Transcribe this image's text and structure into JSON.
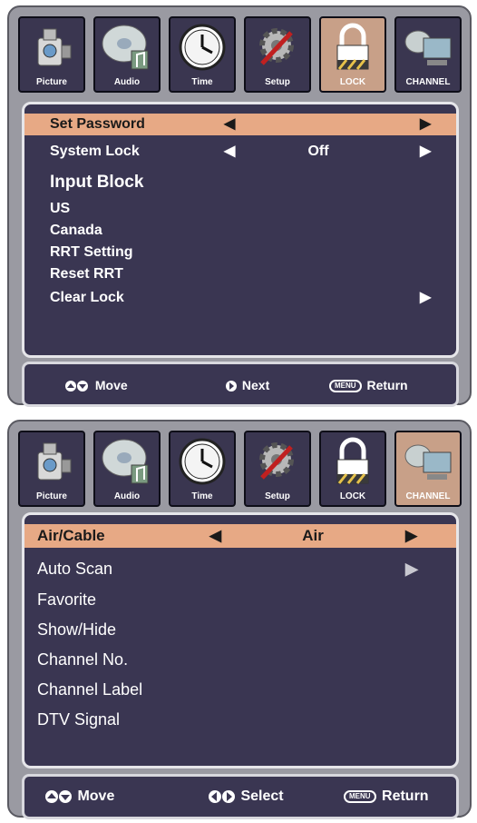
{
  "tabs": [
    {
      "label": "Picture",
      "icon": "camera-icon"
    },
    {
      "label": "Audio",
      "icon": "audio-disc-icon"
    },
    {
      "label": "Time",
      "icon": "clock-icon"
    },
    {
      "label": "Setup",
      "icon": "gear-wrench-icon"
    },
    {
      "label": "LOCK",
      "icon": "padlock-icon"
    },
    {
      "label": "CHANNEL",
      "icon": "satellite-computer-icon"
    }
  ],
  "lock_menu": {
    "active_tab": "LOCK",
    "items": [
      {
        "label": "Set Password",
        "value": ""
      },
      {
        "label": "System Lock",
        "value": "Off"
      },
      {
        "label": "Input Block"
      },
      {
        "label": "US"
      },
      {
        "label": "Canada"
      },
      {
        "label": "RRT Setting"
      },
      {
        "label": "Reset RRT"
      },
      {
        "label": "Clear Lock"
      }
    ],
    "footer": {
      "move": "Move",
      "next": "Next",
      "menu_key": "MENU",
      "return": "Return"
    }
  },
  "channel_menu": {
    "active_tab": "CHANNEL",
    "items": [
      {
        "label": "Air/Cable",
        "value": "Air"
      },
      {
        "label": "Auto Scan"
      },
      {
        "label": "Favorite"
      },
      {
        "label": "Show/Hide"
      },
      {
        "label": "Channel No."
      },
      {
        "label": "Channel Label"
      },
      {
        "label": "DTV Signal"
      }
    ],
    "footer": {
      "move": "Move",
      "select": "Select",
      "menu_key": "MENU",
      "return": "Return"
    }
  },
  "colors": {
    "panel_bg": "#9a9aa2",
    "menu_bg": "#3a3652",
    "highlight": "#e7a985",
    "active_tab": "#c8a088"
  }
}
